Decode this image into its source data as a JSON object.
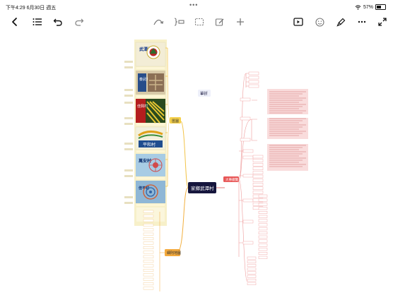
{
  "status_bar": {
    "time": "下午4:29",
    "date": "6月30日 週五",
    "battery": "57%"
  },
  "mindmap": {
    "central_topic": "家鄉武潭村",
    "free_topic": "單折",
    "branches": {
      "left_top": "匯圖",
      "left_bottom": "細則地圖",
      "right": "大事總覽"
    },
    "emblem_labels": [
      "武潭村",
      "泰武村",
      "佳興村",
      "平和村",
      "萬安村",
      "佳平村"
    ]
  }
}
